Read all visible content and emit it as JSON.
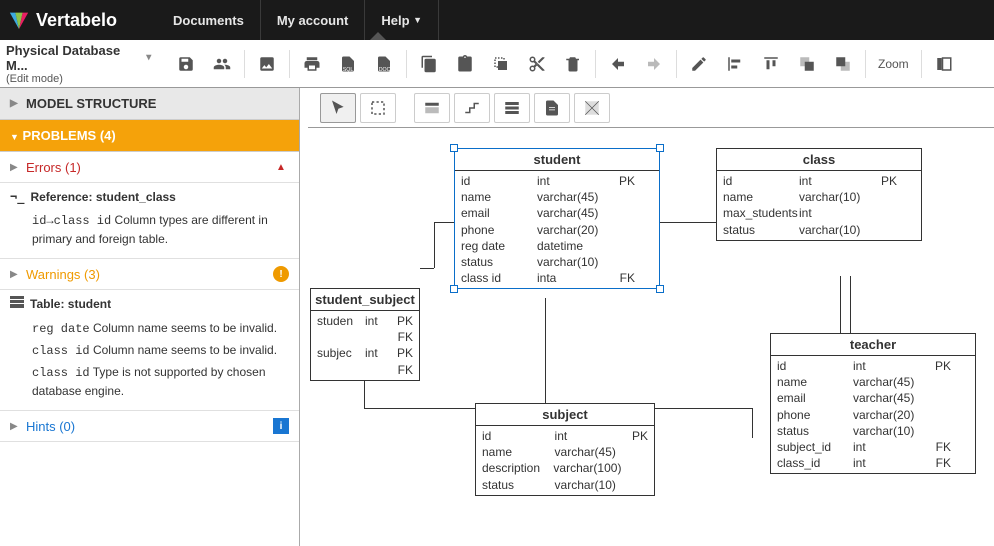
{
  "brand": "Vertabelo",
  "nav": {
    "documents": "Documents",
    "account": "My account",
    "help": "Help"
  },
  "doc": {
    "title": "Physical Database M...",
    "subtitle": "(Edit mode)"
  },
  "zoom": "Zoom",
  "sidebar": {
    "model_structure": "MODEL STRUCTURE",
    "problems": "PROBLEMS (4)",
    "errors": "Errors (1)",
    "warnings": "Warnings (3)",
    "hints": "Hints (0)",
    "ref_block": {
      "title": "Reference: student_class",
      "msg_pre": "id→class id",
      "msg_tail": " Column types are different in primary and foreign table."
    },
    "tbl_block": {
      "title": "Table: student",
      "m1_pre": "reg date",
      "m1_tail": " Column name seems to be invalid.",
      "m2_pre": "class id",
      "m2_tail": " Column name seems to be invalid.",
      "m3_pre": "class id",
      "m3_tail": " Type is not supported by chosen database engine."
    }
  },
  "tables": {
    "student": {
      "name": "student",
      "rows": [
        {
          "c1": "id",
          "c2": "int",
          "c3": "PK"
        },
        {
          "c1": "name",
          "c2": "varchar(45)",
          "c3": ""
        },
        {
          "c1": "email",
          "c2": "varchar(45)",
          "c3": ""
        },
        {
          "c1": "phone",
          "c2": "varchar(20)",
          "c3": ""
        },
        {
          "c1": "reg date",
          "c2": "datetime",
          "c3": ""
        },
        {
          "c1": "status",
          "c2": "varchar(10)",
          "c3": ""
        },
        {
          "c1": "class id",
          "c2": "inta",
          "c3": "FK"
        }
      ]
    },
    "class": {
      "name": "class",
      "rows": [
        {
          "c1": "id",
          "c2": "int",
          "c3": "PK"
        },
        {
          "c1": "name",
          "c2": "varchar(10)",
          "c3": ""
        },
        {
          "c1": "max_students",
          "c2": "int",
          "c3": ""
        },
        {
          "c1": "status",
          "c2": "varchar(10)",
          "c3": ""
        }
      ]
    },
    "student_subject": {
      "name": "student_subject",
      "rows": [
        {
          "c1": "studen",
          "c2": "int",
          "c3": "PK FK"
        },
        {
          "c1": "subjec",
          "c2": "int",
          "c3": "PK FK"
        }
      ]
    },
    "subject": {
      "name": "subject",
      "rows": [
        {
          "c1": "id",
          "c2": "int",
          "c3": "PK"
        },
        {
          "c1": "name",
          "c2": "varchar(45)",
          "c3": ""
        },
        {
          "c1": "description",
          "c2": "varchar(100)",
          "c3": ""
        },
        {
          "c1": "status",
          "c2": "varchar(10)",
          "c3": ""
        }
      ]
    },
    "teacher": {
      "name": "teacher",
      "rows": [
        {
          "c1": "id",
          "c2": "int",
          "c3": "PK"
        },
        {
          "c1": "name",
          "c2": "varchar(45)",
          "c3": ""
        },
        {
          "c1": "email",
          "c2": "varchar(45)",
          "c3": ""
        },
        {
          "c1": "phone",
          "c2": "varchar(20)",
          "c3": ""
        },
        {
          "c1": "status",
          "c2": "varchar(10)",
          "c3": ""
        },
        {
          "c1": "subject_id",
          "c2": "int",
          "c3": "FK"
        },
        {
          "c1": "class_id",
          "c2": "int",
          "c3": "FK"
        }
      ]
    }
  }
}
